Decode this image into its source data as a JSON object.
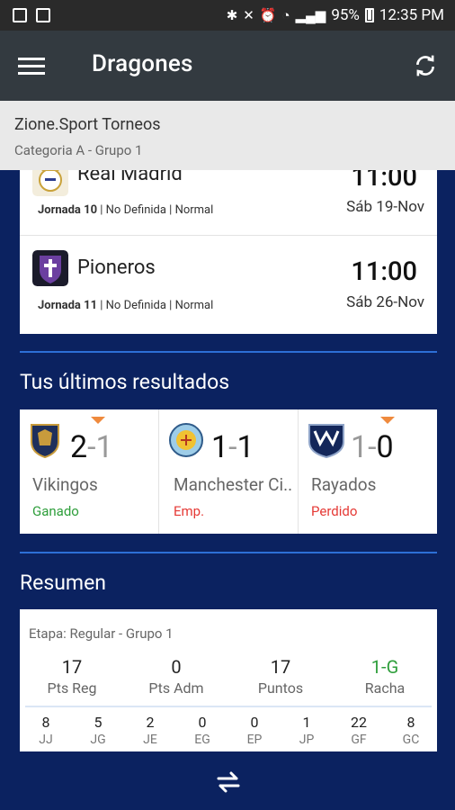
{
  "status": {
    "battery": "95%",
    "time": "12:35 PM"
  },
  "appbar": {
    "title": "Dragones"
  },
  "tournament": {
    "name": "Zione.Sport Torneos",
    "category": "Categoria A - Grupo 1"
  },
  "matches": [
    {
      "team": "Real Madrid",
      "jornada": "Jornada 10",
      "meta": " | No Definida | Normal",
      "time": "11:00",
      "date": "Sáb 19-Nov"
    },
    {
      "team": "Pioneros",
      "jornada": "Jornada 11",
      "meta": " | No Definida | Normal",
      "time": "11:00",
      "date": "Sáb 26-Nov"
    }
  ],
  "results_title": "Tus últimos resultados",
  "results": [
    {
      "team": "Vikingos",
      "score_a": "2",
      "score_b": "1",
      "outcome": "Ganado",
      "outcome_color": "#2e9e3b"
    },
    {
      "team": "Manchester Ci..",
      "score_a": "1",
      "score_b": "1",
      "outcome": "Emp.",
      "outcome_color": "#e53935"
    },
    {
      "team": "Rayados",
      "score_a": "1",
      "score_b": "0",
      "outcome": "Perdido",
      "outcome_color": "#e53935"
    }
  ],
  "summary_title": "Resumen",
  "summary": {
    "etapa": "Etapa: Regular - Grupo 1",
    "main": [
      {
        "value": "17",
        "label": "Pts Reg"
      },
      {
        "value": "0",
        "label": "Pts Adm"
      },
      {
        "value": "17",
        "label": "Puntos"
      },
      {
        "value": "1-G",
        "label": "Racha"
      }
    ],
    "detail": [
      {
        "value": "8",
        "label": "JJ"
      },
      {
        "value": "5",
        "label": "JG"
      },
      {
        "value": "2",
        "label": "JE"
      },
      {
        "value": "0",
        "label": "EG"
      },
      {
        "value": "0",
        "label": "EP"
      },
      {
        "value": "1",
        "label": "JP"
      },
      {
        "value": "22",
        "label": "GF"
      },
      {
        "value": "8",
        "label": "GC"
      }
    ]
  },
  "colors": {
    "racha": "#2e9e3b",
    "accent": "#2d6fd6",
    "background": "#0b2260"
  }
}
